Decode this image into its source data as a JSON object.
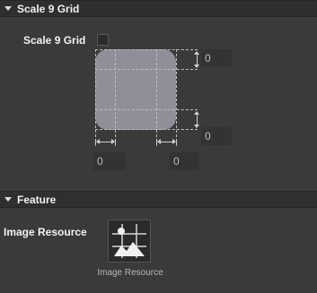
{
  "scale9": {
    "header_title": "Scale 9 Grid",
    "checkbox_label": "Scale 9 Grid",
    "checked": false,
    "top": "0",
    "bottom": "0",
    "left": "0",
    "right": "0"
  },
  "feature": {
    "header_title": "Feature",
    "image_resource_label": "Image Resource",
    "image_resource_caption": "Image Resource",
    "image_resource_icon": "image-placeholder-icon"
  },
  "colors": {
    "panel_bg": "#3a3a3a",
    "header_bg": "#2f2f2f",
    "preview_fill": "#918d99"
  }
}
